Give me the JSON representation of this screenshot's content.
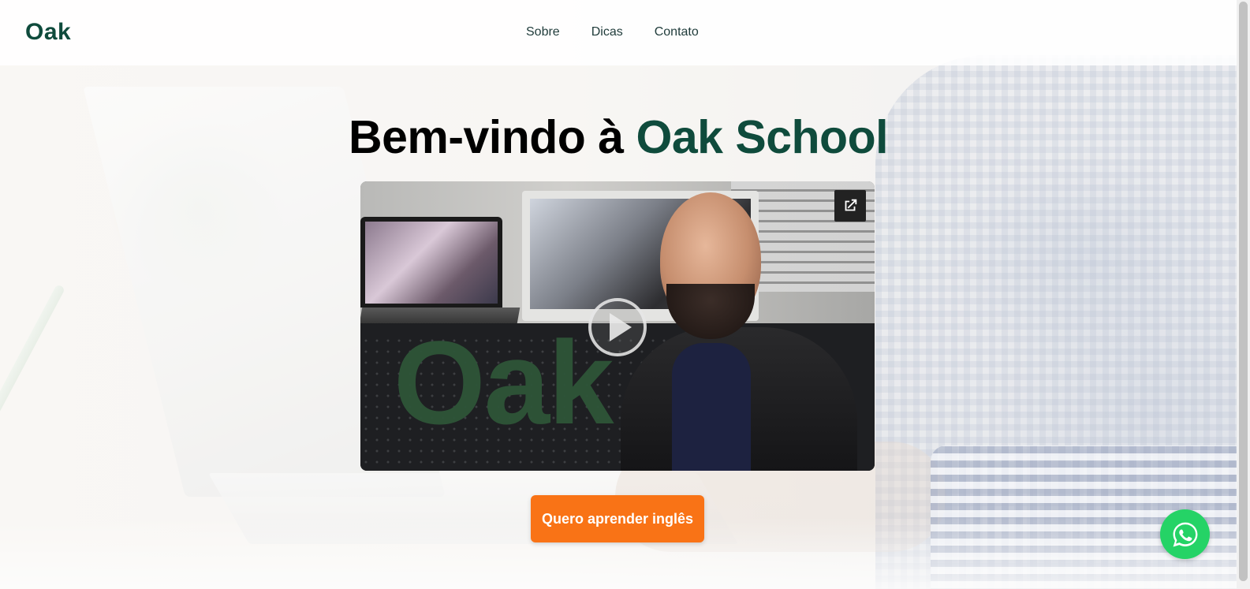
{
  "brand": {
    "logo": "Oak"
  },
  "nav": {
    "items": [
      {
        "label": "Sobre"
      },
      {
        "label": "Dicas"
      },
      {
        "label": "Contato"
      }
    ]
  },
  "hero": {
    "title_prefix": "Bem-vindo à",
    "title_accent": "Oak School",
    "video": {
      "watermark": "Oak",
      "play_icon": "play-icon",
      "external_link_icon": "open-in-new-icon"
    },
    "cta_label": "Quero aprender inglês"
  },
  "floating": {
    "whatsapp_icon": "whatsapp-icon"
  },
  "colors": {
    "brand_green": "#0f4b3c",
    "cta_orange": "#f97316",
    "whatsapp_green": "#25d366"
  }
}
